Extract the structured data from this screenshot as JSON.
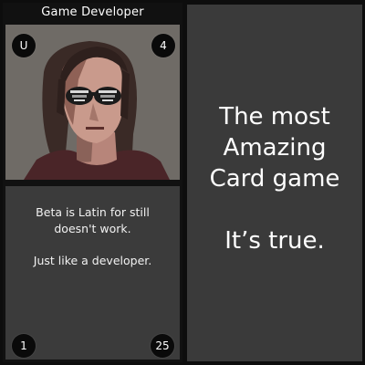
{
  "card": {
    "title": "Game Developer",
    "rarity": "U",
    "cost": "4",
    "description_line1": "Beta is Latin for still doesn't work.",
    "description_line2": "Just like a developer.",
    "attack": "1",
    "health": "25"
  },
  "promo": {
    "line1": "The most",
    "line2": "Amazing",
    "line3": "Card game",
    "line4": "It’s true."
  }
}
